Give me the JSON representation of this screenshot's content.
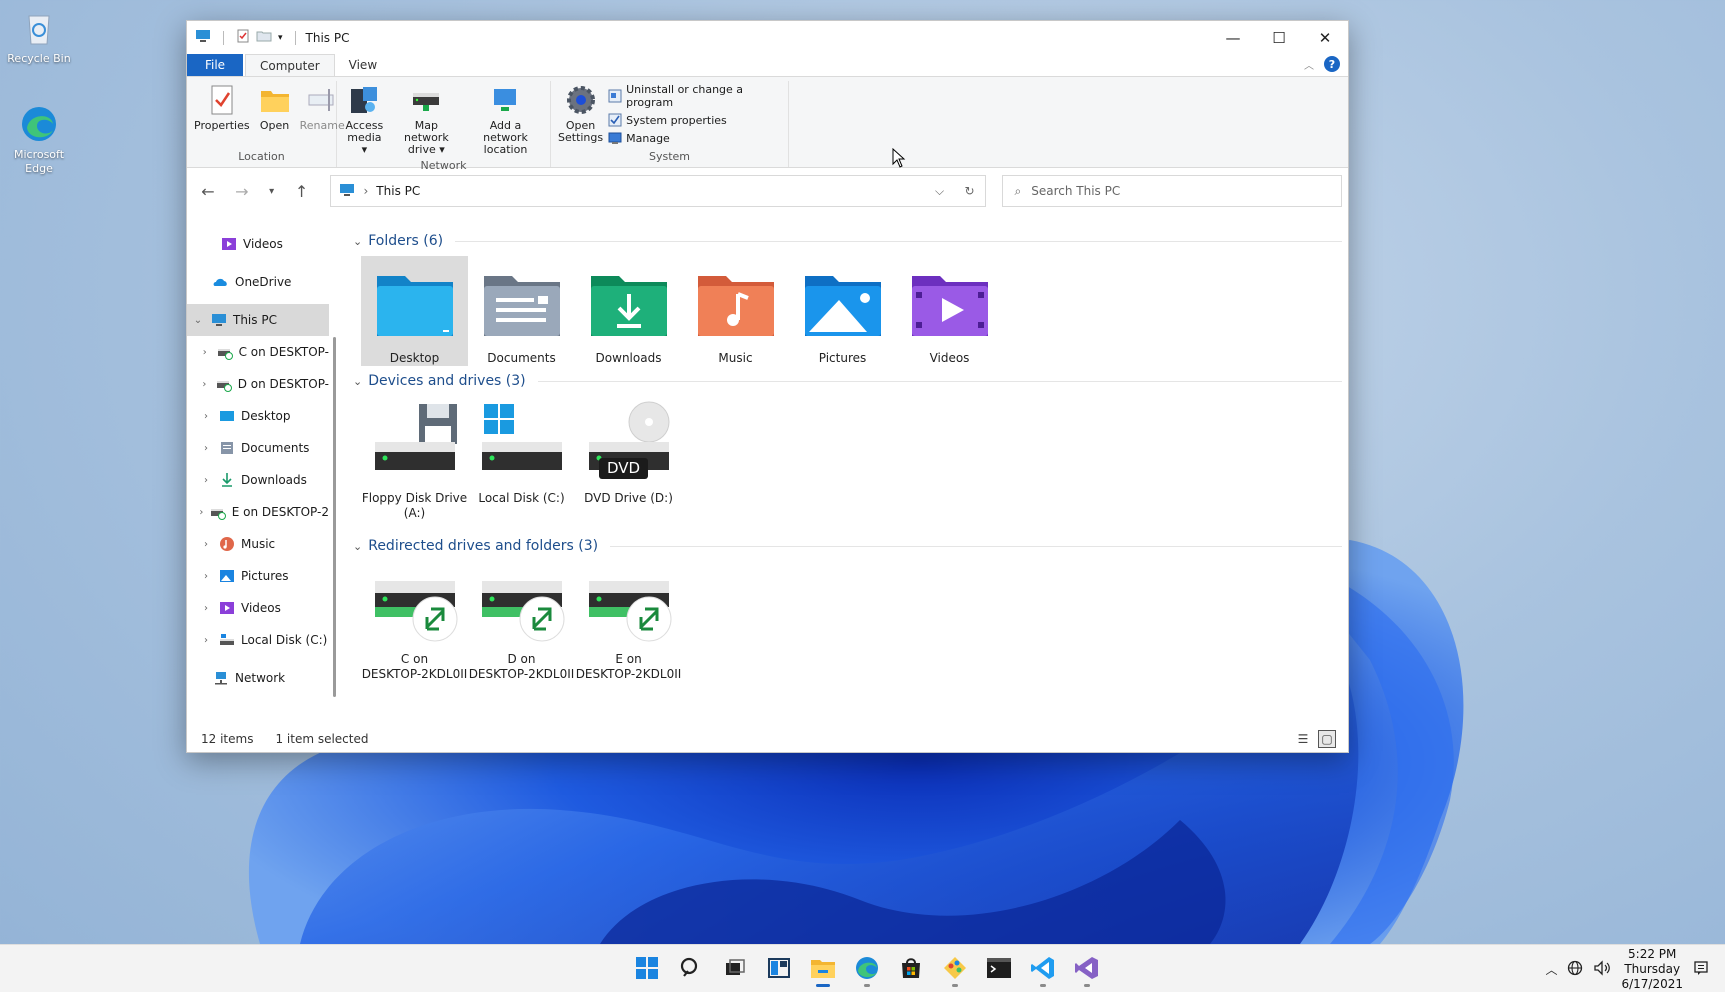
{
  "desktop": {
    "icons": [
      {
        "label": "Recycle Bin",
        "icon": "recycle-bin-icon"
      },
      {
        "label": "Microsoft Edge",
        "icon": "edge-icon"
      }
    ]
  },
  "window": {
    "title": "This PC",
    "controls": {
      "minimize": "—",
      "maximize": "☐",
      "close": "✕"
    }
  },
  "ribbon": {
    "tabs": [
      "File",
      "Computer",
      "View"
    ],
    "groups": {
      "location": {
        "label": "Location",
        "buttons": [
          "Properties",
          "Open",
          "Rename"
        ]
      },
      "network": {
        "label": "Network",
        "buttons": [
          {
            "line1": "Access",
            "line2": "media ▾"
          },
          {
            "line1": "Map network",
            "line2": "drive ▾"
          },
          {
            "line1": "Add a network",
            "line2": "location"
          }
        ]
      },
      "system": {
        "label": "System",
        "open_settings": {
          "line1": "Open",
          "line2": "Settings"
        },
        "small": [
          "Uninstall or change a program",
          "System properties",
          "Manage"
        ]
      }
    }
  },
  "nav": {
    "breadcrumb": "This PC",
    "search_placeholder": "Search This PC"
  },
  "tree": {
    "items": [
      {
        "label": "Videos",
        "icon": "videos-icon"
      },
      {
        "label": "OneDrive",
        "icon": "onedrive-icon"
      },
      {
        "label": "This PC",
        "icon": "this-pc-icon"
      },
      {
        "label": "C on DESKTOP-",
        "icon": "network-drive-icon"
      },
      {
        "label": "D on DESKTOP-",
        "icon": "network-drive-icon"
      },
      {
        "label": "Desktop",
        "icon": "desktop-folder-icon"
      },
      {
        "label": "Documents",
        "icon": "documents-icon"
      },
      {
        "label": "Downloads",
        "icon": "downloads-icon"
      },
      {
        "label": "E on DESKTOP-2",
        "icon": "network-drive-icon"
      },
      {
        "label": "Music",
        "icon": "music-icon"
      },
      {
        "label": "Pictures",
        "icon": "pictures-icon"
      },
      {
        "label": "Videos",
        "icon": "videos-icon"
      },
      {
        "label": "Local Disk (C:)",
        "icon": "local-disk-icon"
      },
      {
        "label": "Network",
        "icon": "network-icon"
      }
    ]
  },
  "groups": {
    "folders": {
      "header": "Folders (6)",
      "items": [
        "Desktop",
        "Documents",
        "Downloads",
        "Music",
        "Pictures",
        "Videos"
      ]
    },
    "devices": {
      "header": "Devices and drives (3)",
      "items": [
        {
          "line1": "Floppy Disk Drive",
          "line2": "(A:)"
        },
        {
          "line1": "Local Disk (C:)",
          "line2": ""
        },
        {
          "line1": "DVD Drive (D:)",
          "line2": "",
          "badge": "DVD"
        }
      ]
    },
    "redirected": {
      "header": "Redirected drives and folders (3)",
      "items": [
        {
          "line1": "C on",
          "line2": "DESKTOP-2KDL0II"
        },
        {
          "line1": "D on",
          "line2": "DESKTOP-2KDL0II"
        },
        {
          "line1": "E on",
          "line2": "DESKTOP-2KDL0II"
        }
      ]
    }
  },
  "status": {
    "count": "12 items",
    "selection": "1 item selected"
  },
  "taskbar": {
    "apps": [
      "start-icon",
      "search-icon",
      "task-view-icon",
      "widgets-icon",
      "file-explorer-icon",
      "edge-icon",
      "store-icon",
      "paint-icon",
      "terminal-icon",
      "vscode-icon",
      "visual-studio-icon"
    ]
  },
  "clock": {
    "time": "5:22 PM",
    "day": "Thursday",
    "date": "6/17/2021"
  },
  "colors": {
    "accent": "#1a66c4",
    "group_header": "#1e4e8c",
    "taskbar": "#f3f3f3"
  }
}
